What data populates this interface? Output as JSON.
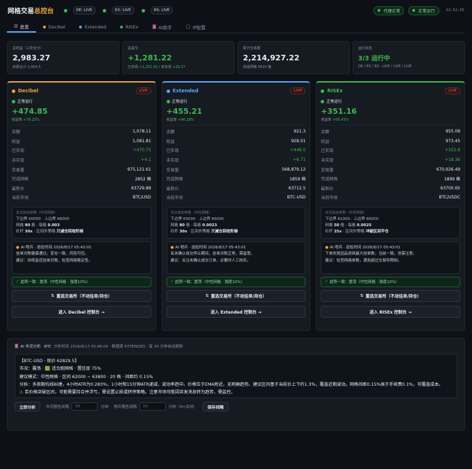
{
  "header": {
    "title_main": "网格交易",
    "title_accent": "总控台",
    "badges": [
      {
        "label": "DE: LIVE"
      },
      {
        "label": "EX: LIVE"
      },
      {
        "label": "RS: LIVE"
      }
    ],
    "status_pills": [
      {
        "label": "代理正常"
      },
      {
        "label": "正常运行"
      }
    ],
    "clock": "22:52:55"
  },
  "tabs": [
    {
      "label": "总览",
      "icon": "chart-icon",
      "active": true
    },
    {
      "label": "Decibel",
      "icon": "dot",
      "color": "#e8a838"
    },
    {
      "label": "Extended",
      "icon": "dot",
      "color": "#58a6ff"
    },
    {
      "label": "RISEx",
      "icon": "dot",
      "color": "#3fb950"
    },
    {
      "label": "AI助手",
      "icon": "robot-icon"
    },
    {
      "label": "IP配置",
      "icon": "globe-icon"
    }
  ],
  "summary": [
    {
      "label": "总权益（三所合计）",
      "value": "2,983.27",
      "sub_prefix": "余额合计",
      "sub_value": "2,954.5",
      "value_green": false
    },
    {
      "label": "总盈亏",
      "value": "+1,281.22",
      "sub_prefix": "已实现",
      "sub_value": "+1,252.05",
      "sub_mid": "/ 未实现",
      "sub_value2": "+29.17",
      "value_green": true
    },
    {
      "label": "累计交易量",
      "value": "2,214,927.22",
      "sub_prefix": "完成网格",
      "sub_value": "6610 格",
      "value_green": false
    },
    {
      "label": "运行状态",
      "value": "3/3 运行中",
      "sub_prefix": "DE / EX / RS : LIVE / LIVE / LIVE",
      "value_green": true
    }
  ],
  "exchanges": [
    {
      "name": "Decibel",
      "color": "#e8a838",
      "live": "LIVE",
      "status": "正常运行",
      "pnl": "+474.85",
      "yield_label": "收益率",
      "yield": "+78.23%",
      "rows": [
        {
          "k": "余额",
          "v": "1,078.11"
        },
        {
          "k": "权益",
          "v": "1,081.81"
        },
        {
          "k": "已实现",
          "v": "+470.75",
          "green": true
        },
        {
          "k": "未实现",
          "v": "+4.1",
          "green": true
        },
        {
          "k": "交易量",
          "v": "975,121.61"
        },
        {
          "k": "完成网格",
          "v": "2852 格"
        },
        {
          "k": "最新价",
          "v": "63729.88"
        },
        {
          "k": "当前市场",
          "v": "BTC/USD"
        }
      ],
      "param_title": "本次启动参数（中性网格）",
      "param_line1": "下边界 60000 · 上边界 66000",
      "param_line2_a": "网格",
      "param_line2_b": "90",
      "param_line2_c": "格 · 每格",
      "param_line2_d": "0.003",
      "param_line3_a": "杠杆",
      "param_line3_b": "30x",
      "param_line3_c": "· 区间外策略",
      "param_line3_d": "只减仓回收阶梯",
      "ai_title": "AI 哨兵 · 巡检时间 2026/8/17 05:43:01",
      "ai_line1": "挂单对账健康通过，变化一致，风险可控。",
      "ai_line2": "建议：持续监控挂单对账，检查网格稳定性。",
      "trend": "趋势一致：震荡（中性网格 · 强度10%）",
      "btn_switch": "重选交易所（不动挂单/持仓）",
      "btn_enter": "进入 Decibel 控制台 →"
    },
    {
      "name": "Extended",
      "color": "#58a6ff",
      "live": "LIVE",
      "status": "正常运行",
      "pnl": "+455.21",
      "yield_label": "收益率",
      "yield": "+96.28%",
      "rows": [
        {
          "k": "余额",
          "v": "921.3"
        },
        {
          "k": "权益",
          "v": "928.01"
        },
        {
          "k": "已实现",
          "v": "+448.5",
          "green": true
        },
        {
          "k": "未实现",
          "v": "+6.71",
          "green": true
        },
        {
          "k": "交易量",
          "v": "568,879.12"
        },
        {
          "k": "完成网格",
          "v": "1859 格"
        },
        {
          "k": "最新价",
          "v": "63712.5"
        },
        {
          "k": "当前市场",
          "v": "BTC-USD"
        }
      ],
      "param_title": "本次启动参数（中性网格）",
      "param_line1": "下边界 60000 · 上边界 66000",
      "param_line2_a": "网格",
      "param_line2_b": "80",
      "param_line2_c": "格 · 每格",
      "param_line2_d": "0.0023",
      "param_line3_a": "杠杆",
      "param_line3_b": "30x",
      "param_line3_c": "· 区间外策略",
      "param_line3_d": "只减仓回收阶梯",
      "ai_title": "AI 哨兵 · 巡检时间 2026/8/17 05:43:01",
      "ai_line1": "有未确认成交停止期间，挂单对账正常，需留意。",
      "ai_line2": "建议：关注未确认成交订单，必要时人工核实。",
      "trend": "趋势一致：震荡（中性网格 · 强度10%）",
      "btn_switch": "重选交易所（不动挂单/持仓）",
      "btn_enter": "进入 Extended 控制台 →"
    },
    {
      "name": "RISEx",
      "color": "#3fb950",
      "live": "LIVE",
      "status": "正常运行",
      "pnl": "+351.16",
      "yield_label": "收益率",
      "yield": "+56.43%",
      "rows": [
        {
          "k": "余额",
          "v": "955.09"
        },
        {
          "k": "权益",
          "v": "973.45"
        },
        {
          "k": "已实现",
          "v": "+332.8",
          "green": true
        },
        {
          "k": "未实现",
          "v": "+18.36",
          "green": true
        },
        {
          "k": "交易量",
          "v": "670,926.49"
        },
        {
          "k": "完成网格",
          "v": "1899 格"
        },
        {
          "k": "最新价",
          "v": "63700.65"
        },
        {
          "k": "当前市场",
          "v": "BTC/USDC"
        }
      ],
      "param_title": "本次启动参数（中性网格）",
      "param_line1": "下边界 61000 · 上边界 66000",
      "param_line2_a": "网格",
      "param_line2_b": "50",
      "param_line2_c": "格 · 每格",
      "param_line2_d": "0.0025",
      "param_line3_a": "杠杆",
      "param_line3_b": "25x",
      "param_line3_c": "· 区间外策略",
      "param_line3_d": "冲破区间平仓",
      "ai_title": "AI 哨兵 · 巡检时间 2026/8/17 05:43:01",
      "ai_line1": "下单失败因品类网最大挂单数，当前一致，但需注意。",
      "ai_line2": "建议：检查网格参数，避免超过交易所限制。",
      "trend": "趋势一致：震荡（中性网格 · 强度10%）",
      "btn_switch": "重选交易所（不动挂单/持仓）",
      "btn_enter": "进入 RISEx 控制台 →"
    }
  ],
  "analysis": {
    "title": "AI 市况分析 · BTC",
    "meta": "分析时间 2026/8/17 05:46:04 · 数据源 EXTENDED · 每 30 分钟自动更新",
    "lines": [
      "【BTC-USD · 现价 62829.5】",
      "市况：震荡 · 🟩 适合跑网格 · 置信度 75%",
      "建议模式：中性网格 · 区间 62000 ~ 63800 · 20 格 · 间距约 0.15%",
      "分析：多周期均线纠缠，4小时ATR为0.283%，1小时和15分钟ATR递减，波动率趋中。价格位于EMA附近，无明确趋势。建议区间基于当前价上下约1.3%，覆盖近期波动。网格间距0.15%高于手续费0.1%，可覆盖成本。"
    ],
    "warning": "若价格突破区间，可能需要持合并浮亏，需设置止损或转停策略。注意市场可能因突发消息转为趋势，需监控。",
    "btn_analyze": "立即分析",
    "interval_label": "市况报告间隔",
    "interval_placeholder": "30",
    "interval_unit": "分钟 ·",
    "sentinel_label": "哨兵报告间隔",
    "sentinel_placeholder": "10",
    "sentinel_unit": "分钟（0=关闭）",
    "btn_save": "保存间隔"
  }
}
